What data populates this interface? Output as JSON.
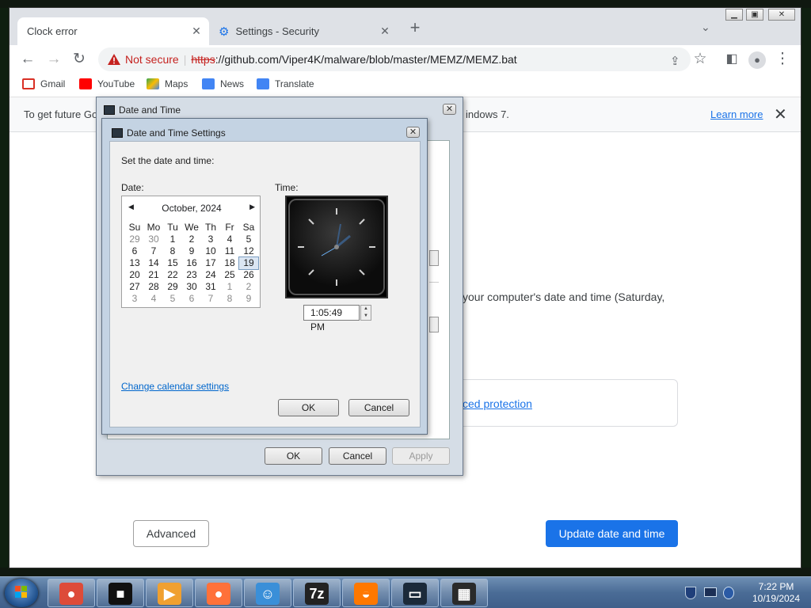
{
  "browser": {
    "tabs": [
      {
        "title": "Clock error",
        "active": true
      },
      {
        "title": "Settings - Security",
        "active": false
      }
    ],
    "new_tab": "+",
    "address": {
      "security_label": "Not secure",
      "scheme": "https",
      "url_rest": "://github.com/Viper4K/malware/blob/master/MEMZ/MEMZ.bat"
    },
    "bookmarks": [
      {
        "label": "Gmail",
        "icon": "gmail-icon",
        "color": "#d93025"
      },
      {
        "label": "YouTube",
        "icon": "youtube-icon",
        "color": "#ff0000"
      },
      {
        "label": "Maps",
        "icon": "maps-icon",
        "color": "#34a853"
      },
      {
        "label": "News",
        "icon": "news-icon",
        "color": "#4285f4"
      },
      {
        "label": "Translate",
        "icon": "translate-icon",
        "color": "#4285f4"
      }
    ],
    "infobar": {
      "text_start": "To get future Go",
      "text_end": "indows 7.",
      "link": "Learn more"
    }
  },
  "page": {
    "body_text": "your computer's date and time (Saturday,",
    "protection_link": "ced protection",
    "advanced_button": "Advanced",
    "update_button": "Update date and time",
    "accent_color": "#1a73e8"
  },
  "outer_dialog": {
    "title": "Date and Time",
    "ok": "OK",
    "cancel": "Cancel",
    "apply": "Apply"
  },
  "inner_dialog": {
    "title": "Date and Time Settings",
    "instruction": "Set the date and time:",
    "date_label": "Date:",
    "time_label": "Time:",
    "calendar": {
      "month": "October, 2024",
      "weekdays": [
        "Su",
        "Mo",
        "Tu",
        "We",
        "Th",
        "Fr",
        "Sa"
      ],
      "weeks": [
        [
          "29",
          "30",
          "1",
          "2",
          "3",
          "4",
          "5"
        ],
        [
          "6",
          "7",
          "8",
          "9",
          "10",
          "11",
          "12"
        ],
        [
          "13",
          "14",
          "15",
          "16",
          "17",
          "18",
          "19"
        ],
        [
          "20",
          "21",
          "22",
          "23",
          "24",
          "25",
          "26"
        ],
        [
          "27",
          "28",
          "29",
          "30",
          "31",
          "1",
          "2"
        ],
        [
          "3",
          "4",
          "5",
          "6",
          "7",
          "8",
          "9"
        ]
      ],
      "selected_day": "19"
    },
    "time_value": "1:05:49 PM",
    "calendar_settings_link": "Change calendar settings",
    "ok": "OK",
    "cancel": "Cancel"
  },
  "taskbar": {
    "apps": [
      {
        "name": "chrome-icon",
        "glyph": "●",
        "color": "#dd4b39"
      },
      {
        "name": "terminal-box-icon",
        "glyph": "■",
        "color": "#111111"
      },
      {
        "name": "media-player-icon",
        "glyph": "▶",
        "color": "#f0a030"
      },
      {
        "name": "firefox-icon",
        "glyph": "●",
        "color": "#ff7139"
      },
      {
        "name": "messenger-icon",
        "glyph": "☺",
        "color": "#3a8fd8"
      },
      {
        "name": "7zip-icon",
        "glyph": "7z",
        "color": "#222222"
      },
      {
        "name": "avast-icon",
        "glyph": "◒",
        "color": "#ff7800"
      },
      {
        "name": "network-card-icon",
        "glyph": "▭",
        "color": "#1b2a3a"
      },
      {
        "name": "calculator-icon",
        "glyph": "▦",
        "color": "#2a2a2a"
      }
    ],
    "clock_time": "7:22 PM",
    "clock_date": "10/19/2024"
  }
}
